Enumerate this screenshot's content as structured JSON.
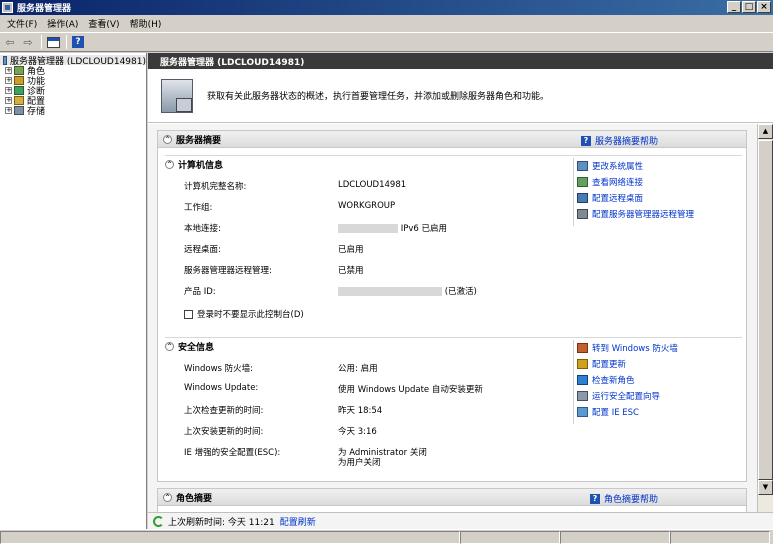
{
  "window": {
    "title": "服务器管理器",
    "buttons": [
      "_",
      "□",
      "×"
    ]
  },
  "menu": [
    "文件(F)",
    "操作(A)",
    "查看(V)",
    "帮助(H)"
  ],
  "tree": {
    "root": "服务器管理器 (LDCLOUD14981)",
    "items": [
      "角色",
      "功能",
      "诊断",
      "配置",
      "存储"
    ]
  },
  "right": {
    "header": "服务器管理器 (LDCLOUD14981)",
    "banner_text": "获取有关此服务器状态的概述，执行首要管理任务，并添加或删除服务器角色和功能。"
  },
  "server_summary": {
    "title": "服务器摘要",
    "help": "服务器摘要帮助",
    "computer_info": {
      "title": "计算机信息",
      "fields": [
        {
          "label": "计算机完整名称:",
          "value": "LDCLOUD14981"
        },
        {
          "label": "工作组:",
          "value": "WORKGROUP"
        },
        {
          "label": "本地连接:",
          "value": "IPv6 已启用"
        },
        {
          "label": "远程桌面:",
          "value": "已启用"
        },
        {
          "label": "服务器管理器远程管理:",
          "value": "已禁用"
        },
        {
          "label": "产品 ID:",
          "value": "(已激活)"
        }
      ],
      "checkbox_label": "登录时不要显示此控制台(D)",
      "actions": [
        "更改系统属性",
        "查看网络连接",
        "配置远程桌面",
        "配置服务器管理器远程管理"
      ]
    },
    "security_info": {
      "title": "安全信息",
      "fields": [
        {
          "label": "Windows 防火墙:",
          "value": "公用: 启用"
        },
        {
          "label": "Windows Update:",
          "value": "使用 Windows Update 自动安装更新"
        },
        {
          "label": "上次检查更新的时间:",
          "value": "昨天 18:54"
        },
        {
          "label": "上次安装更新的时间:",
          "value": "今天 3:16"
        },
        {
          "label": "IE 增强的安全配置(ESC):",
          "value": "为 Administrator 关闭",
          "value2": "为用户关闭"
        }
      ],
      "actions": [
        "转到 Windows 防火墙",
        "配置更新",
        "检查新角色",
        "运行安全配置向导",
        "配置 IE ESC"
      ]
    }
  },
  "roles_summary": {
    "title": "角色摘要",
    "help": "角色摘要帮助"
  },
  "refresh": {
    "label": "上次刷新时间: 今天 11:21",
    "link": "配置刷新"
  }
}
